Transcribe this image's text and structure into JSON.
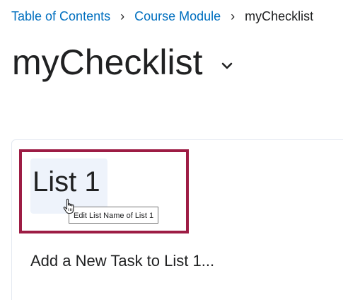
{
  "breadcrumb": {
    "items": [
      {
        "label": "Table of Contents"
      },
      {
        "label": "Course Module"
      }
    ],
    "separator": "›",
    "current": "myChecklist"
  },
  "page": {
    "title": "myChecklist",
    "menu_icon": "chevron-down-icon"
  },
  "checklist": {
    "list_name": "List 1",
    "tooltip": "Edit List Name of List 1",
    "add_task_label": "Add a New Task to List 1...",
    "cursor_icon": "hand-pointer-icon"
  },
  "colors": {
    "link": "#006fbf",
    "text": "#202122",
    "highlight_border": "#9d1c44",
    "hover_background": "#eef3fb"
  }
}
